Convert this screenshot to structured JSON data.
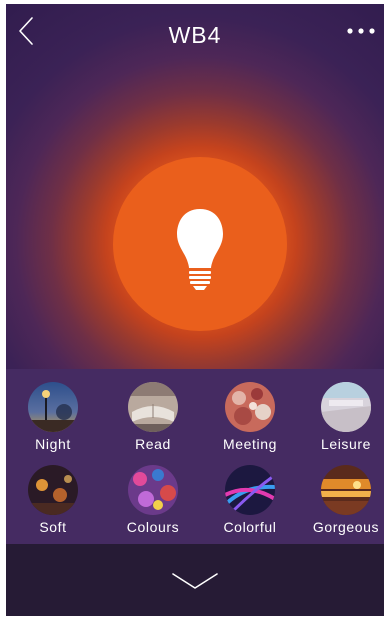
{
  "header": {
    "title": "WB4",
    "back_icon": "chevron-left-icon",
    "menu_icon": "more-dots-icon"
  },
  "main": {
    "power_icon": "lightbulb-icon",
    "accent_color": "#ea5f1c"
  },
  "scenes": [
    {
      "label": "Night",
      "icon": "night-scene-thumbnail"
    },
    {
      "label": "Read",
      "icon": "read-scene-thumbnail"
    },
    {
      "label": "Meeting",
      "icon": "meeting-scene-thumbnail"
    },
    {
      "label": "Leisure",
      "icon": "leisure-scene-thumbnail"
    },
    {
      "label": "Soft",
      "icon": "soft-scene-thumbnail"
    },
    {
      "label": "Colours",
      "icon": "colours-scene-thumbnail"
    },
    {
      "label": "Colorful",
      "icon": "colorful-scene-thumbnail"
    },
    {
      "label": "Gorgeous",
      "icon": "gorgeous-scene-thumbnail"
    }
  ],
  "footer": {
    "collapse_icon": "chevron-down-icon"
  }
}
